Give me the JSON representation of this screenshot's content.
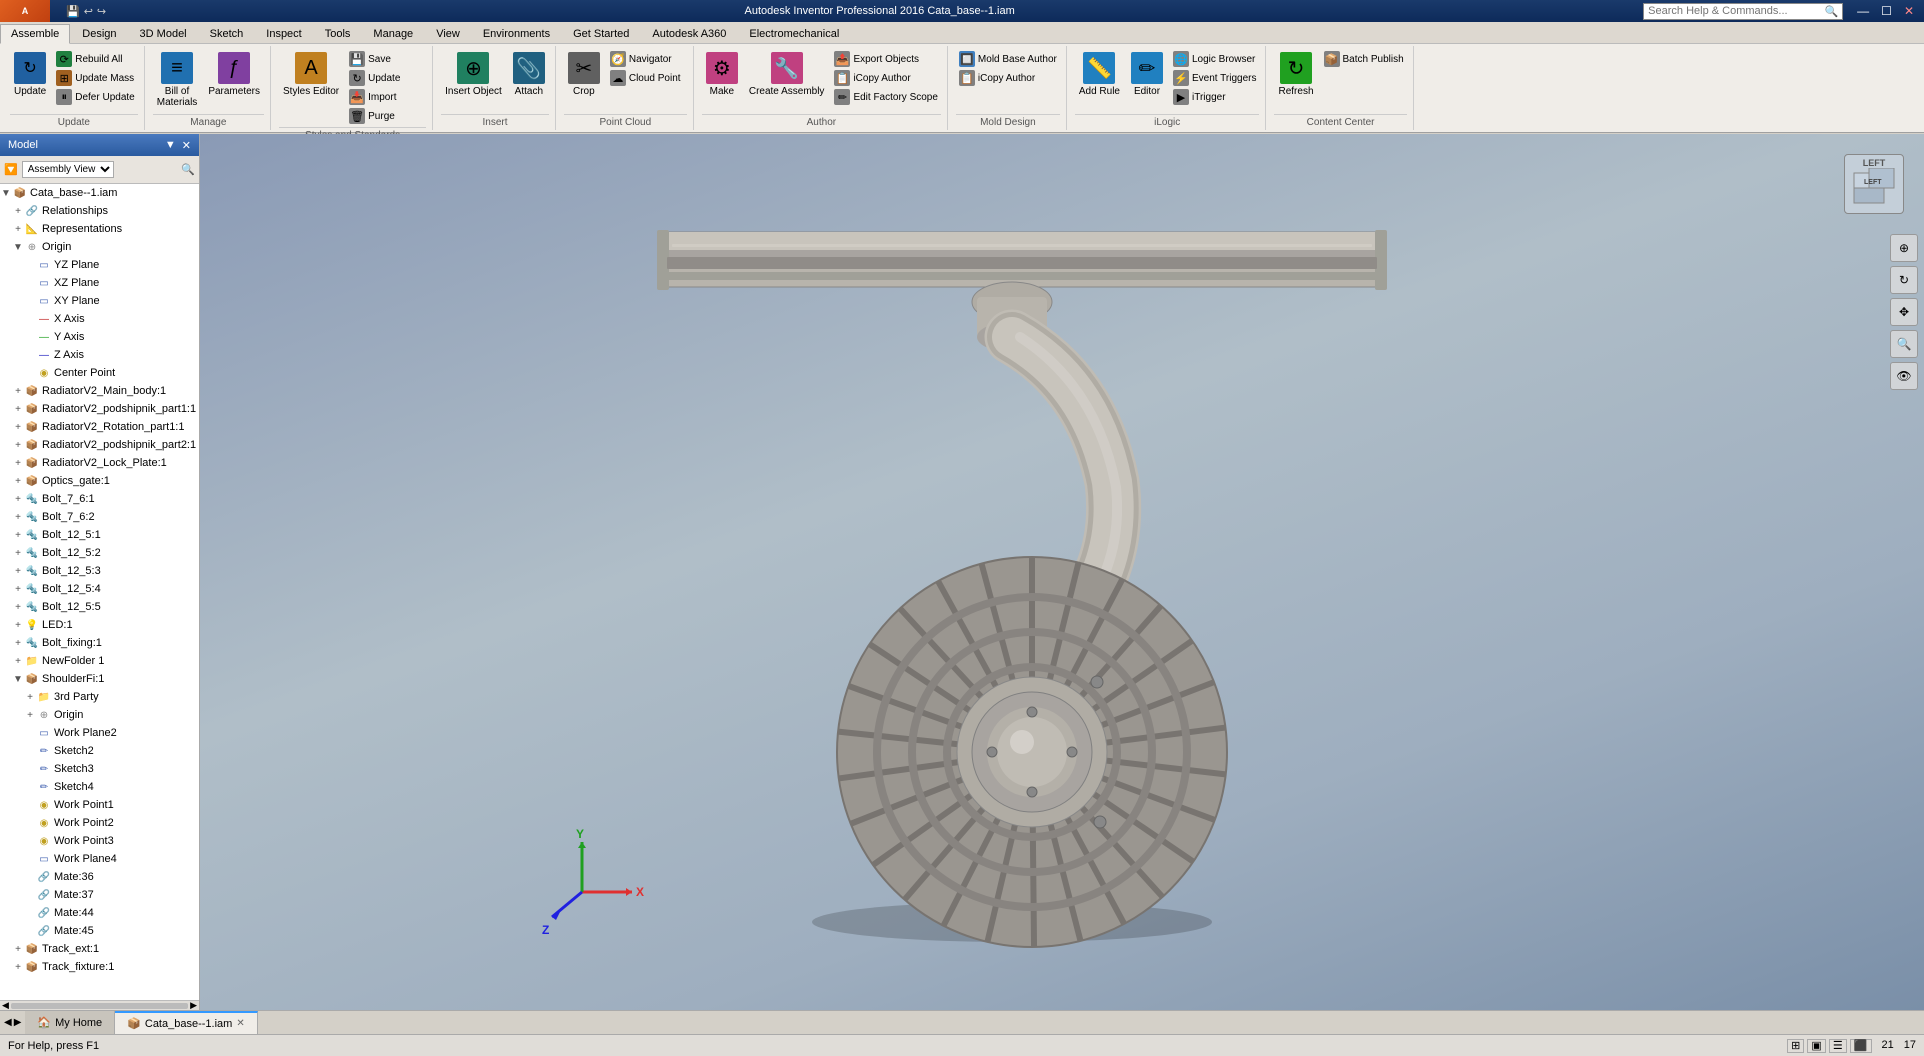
{
  "app": {
    "title": "Autodesk Inventor Professional 2016  Cata_base--1.iam",
    "logo": "A",
    "status": "For Help, press F1",
    "zoom_x": "21",
    "zoom_y": "17"
  },
  "titlebar": {
    "window_controls": [
      "—",
      "☐",
      "✕"
    ]
  },
  "search": {
    "placeholder": "Search Help & Commands..."
  },
  "ribbon": {
    "tabs": [
      {
        "label": "Assemble",
        "active": true
      },
      {
        "label": "Design"
      },
      {
        "label": "3D Model"
      },
      {
        "label": "Sketch"
      },
      {
        "label": "Inspect"
      },
      {
        "label": "Tools"
      },
      {
        "label": "Manage"
      },
      {
        "label": "View"
      },
      {
        "label": "Environments"
      },
      {
        "label": "Get Started"
      },
      {
        "label": "Autodesk A360"
      },
      {
        "label": "Electromechanical"
      }
    ],
    "groups": [
      {
        "name": "Update",
        "buttons": [
          {
            "label": "Update",
            "icon": "↻",
            "size": "large"
          },
          {
            "label": "Rebuild All",
            "icon": "⟳",
            "size": "small"
          },
          {
            "label": "Update Mass",
            "icon": "⊞",
            "size": "small"
          },
          {
            "label": "Defer Update",
            "icon": "⏸",
            "size": "small"
          }
        ]
      },
      {
        "name": "Manage",
        "buttons": [
          {
            "label": "Bill of Materials",
            "icon": "≡",
            "size": "large"
          },
          {
            "label": "Parameters",
            "icon": "ƒ",
            "size": "large"
          }
        ]
      },
      {
        "name": "Styles and Standards",
        "buttons": [
          {
            "label": "Styles Editor",
            "icon": "A",
            "size": "large"
          },
          {
            "label": "Save",
            "icon": "💾",
            "size": "small"
          },
          {
            "label": "Update",
            "icon": "↻",
            "size": "small"
          },
          {
            "label": "Import",
            "icon": "📥",
            "size": "small"
          },
          {
            "label": "Purge",
            "icon": "🗑",
            "size": "small"
          }
        ]
      },
      {
        "name": "Insert",
        "buttons": [
          {
            "label": "Insert Object",
            "icon": "⊕",
            "size": "large"
          },
          {
            "label": "Attach",
            "icon": "📎",
            "size": "large"
          }
        ]
      },
      {
        "name": "Point Cloud",
        "buttons": [
          {
            "label": "Crop",
            "icon": "✂",
            "size": "large"
          },
          {
            "label": "Navigator",
            "icon": "🧭",
            "size": "small"
          },
          {
            "label": "Cloud Point",
            "icon": "☁",
            "size": "small"
          }
        ]
      },
      {
        "name": "Author",
        "buttons": [
          {
            "label": "Make",
            "icon": "⚙",
            "size": "large"
          },
          {
            "label": "Create Assembly",
            "icon": "🔧",
            "size": "large"
          },
          {
            "label": "Export Objects",
            "icon": "📤",
            "size": "small"
          },
          {
            "label": "iCopy Author",
            "icon": "📋",
            "size": "small"
          },
          {
            "label": "Edit Factory Scope",
            "icon": "✏",
            "size": "small"
          }
        ]
      },
      {
        "name": "Mold Design",
        "buttons": [
          {
            "label": "Mold Base Author",
            "icon": "🔲",
            "size": "small"
          },
          {
            "label": "iCopy Author",
            "icon": "📋",
            "size": "small"
          }
        ]
      },
      {
        "name": "iLogic",
        "buttons": [
          {
            "label": "Add Rule",
            "icon": "📏",
            "size": "large"
          },
          {
            "label": "Editor",
            "icon": "✏",
            "size": "large"
          },
          {
            "label": "Logic Browser",
            "icon": "🌐",
            "size": "small"
          },
          {
            "label": "Event Triggers",
            "icon": "⚡",
            "size": "small"
          },
          {
            "label": "iTrigger",
            "icon": "▶",
            "size": "small"
          }
        ]
      },
      {
        "name": "Content Center",
        "buttons": [
          {
            "label": "Refresh",
            "icon": "↻",
            "size": "large"
          },
          {
            "label": "Batch Publish",
            "icon": "📦",
            "size": "small"
          }
        ]
      }
    ]
  },
  "panel": {
    "title": "Model",
    "view_mode": "Assembly View",
    "tree_items": [
      {
        "level": 0,
        "label": "Cata_base--1.iam",
        "expand": "▼",
        "icon": "📦",
        "color": "orange"
      },
      {
        "level": 1,
        "label": "Relationships",
        "expand": "+",
        "icon": "🔗",
        "color": "gray"
      },
      {
        "level": 1,
        "label": "Representations",
        "expand": "+",
        "icon": "📐",
        "color": "gray"
      },
      {
        "level": 1,
        "label": "Origin",
        "expand": "+",
        "icon": "⊕",
        "color": "gray"
      },
      {
        "level": 2,
        "label": "YZ Plane",
        "expand": "",
        "icon": "▭",
        "color": "blue"
      },
      {
        "level": 2,
        "label": "XZ Plane",
        "expand": "",
        "icon": "▭",
        "color": "blue"
      },
      {
        "level": 2,
        "label": "XY Plane",
        "expand": "",
        "icon": "▭",
        "color": "blue"
      },
      {
        "level": 2,
        "label": "X Axis",
        "expand": "",
        "icon": "—",
        "color": "red"
      },
      {
        "level": 2,
        "label": "Y Axis",
        "expand": "",
        "icon": "—",
        "color": "green"
      },
      {
        "level": 2,
        "label": "Z Axis",
        "expand": "",
        "icon": "—",
        "color": "blue"
      },
      {
        "level": 2,
        "label": "Center Point",
        "expand": "",
        "icon": "◉",
        "color": "yellow"
      },
      {
        "level": 1,
        "label": "RadiatorV2_Main_body:1",
        "expand": "+",
        "icon": "📦",
        "color": "yellow"
      },
      {
        "level": 1,
        "label": "RadiatorV2_podshipnik_part1:1",
        "expand": "+",
        "icon": "📦",
        "color": "yellow"
      },
      {
        "level": 1,
        "label": "RadiatorV2_Rotation_part1:1",
        "expand": "+",
        "icon": "📦",
        "color": "yellow"
      },
      {
        "level": 1,
        "label": "RadiatorV2_podshipnik_part2:1",
        "expand": "+",
        "icon": "📦",
        "color": "yellow"
      },
      {
        "level": 1,
        "label": "RadiatorV2_Lock_Plate:1",
        "expand": "+",
        "icon": "📦",
        "color": "yellow"
      },
      {
        "level": 1,
        "label": "Optics_gate:1",
        "expand": "+",
        "icon": "📦",
        "color": "yellow"
      },
      {
        "level": 1,
        "label": "Bolt_7_6:1",
        "expand": "+",
        "icon": "🔩",
        "color": "gray"
      },
      {
        "level": 1,
        "label": "Bolt_7_6:2",
        "expand": "+",
        "icon": "🔩",
        "color": "gray"
      },
      {
        "level": 1,
        "label": "Bolt_12_5:1",
        "expand": "+",
        "icon": "🔩",
        "color": "gray"
      },
      {
        "level": 1,
        "label": "Bolt_12_5:2",
        "expand": "+",
        "icon": "🔩",
        "color": "gray"
      },
      {
        "level": 1,
        "label": "Bolt_12_5:3",
        "expand": "+",
        "icon": "🔩",
        "color": "gray"
      },
      {
        "level": 1,
        "label": "Bolt_12_5:4",
        "expand": "+",
        "icon": "🔩",
        "color": "gray"
      },
      {
        "level": 1,
        "label": "Bolt_12_5:5",
        "expand": "+",
        "icon": "🔩",
        "color": "gray"
      },
      {
        "level": 1,
        "label": "LED:1",
        "expand": "+",
        "icon": "💡",
        "color": "yellow"
      },
      {
        "level": 1,
        "label": "Bolt_fixing:1",
        "expand": "+",
        "icon": "🔩",
        "color": "gray"
      },
      {
        "level": 1,
        "label": "NewFolder 1",
        "expand": "+",
        "icon": "📁",
        "color": "yellow"
      },
      {
        "level": 1,
        "label": "ShoulderFi:1",
        "expand": "▼",
        "icon": "📦",
        "color": "orange"
      },
      {
        "level": 2,
        "label": "3rd Party",
        "expand": "+",
        "icon": "📁",
        "color": "yellow"
      },
      {
        "level": 2,
        "label": "Origin",
        "expand": "+",
        "icon": "⊕",
        "color": "gray"
      },
      {
        "level": 2,
        "label": "Work Plane2",
        "expand": "",
        "icon": "▭",
        "color": "blue"
      },
      {
        "level": 2,
        "label": "Sketch2",
        "expand": "",
        "icon": "✏",
        "color": "blue"
      },
      {
        "level": 2,
        "label": "Sketch3",
        "expand": "",
        "icon": "✏",
        "color": "blue"
      },
      {
        "level": 2,
        "label": "Sketch4",
        "expand": "",
        "icon": "✏",
        "color": "blue"
      },
      {
        "level": 2,
        "label": "Work Point1",
        "expand": "",
        "icon": "◉",
        "color": "yellow"
      },
      {
        "level": 2,
        "label": "Work Point2",
        "expand": "",
        "icon": "◉",
        "color": "yellow"
      },
      {
        "level": 2,
        "label": "Work Point3",
        "expand": "",
        "icon": "◉",
        "color": "yellow"
      },
      {
        "level": 2,
        "label": "Work Plane4",
        "expand": "",
        "icon": "▭",
        "color": "blue"
      },
      {
        "level": 2,
        "label": "Mate:36",
        "expand": "",
        "icon": "🔗",
        "color": "blue"
      },
      {
        "level": 2,
        "label": "Mate:37",
        "expand": "",
        "icon": "🔗",
        "color": "blue"
      },
      {
        "level": 2,
        "label": "Mate:44",
        "expand": "",
        "icon": "🔗",
        "color": "blue"
      },
      {
        "level": 2,
        "label": "Mate:45",
        "expand": "",
        "icon": "🔗",
        "color": "blue"
      },
      {
        "level": 1,
        "label": "Track_ext:1",
        "expand": "+",
        "icon": "📦",
        "color": "yellow"
      },
      {
        "level": 1,
        "label": "Track_fixture:1",
        "expand": "+",
        "icon": "📦",
        "color": "yellow"
      }
    ]
  },
  "viewport": {
    "view_label": "LEFT",
    "axes": {
      "x_color": "#e03030",
      "y_color": "#20a020",
      "z_color": "#2020e0"
    }
  },
  "tabs": [
    {
      "label": "My Home",
      "active": false,
      "closable": false
    },
    {
      "label": "Cata_base--1.iam",
      "active": true,
      "closable": true
    }
  ]
}
